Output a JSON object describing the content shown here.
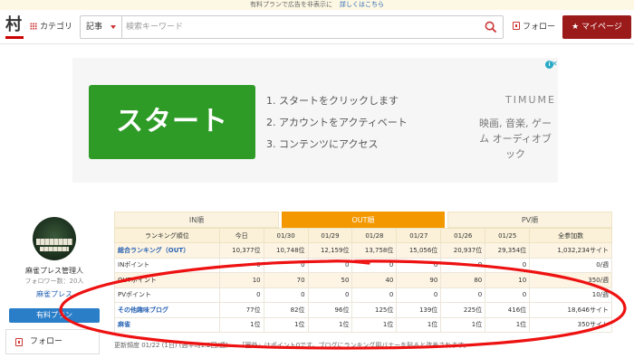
{
  "topbar": {
    "text": "有料プランで広告を非表示に",
    "link": "詳しくはこちら"
  },
  "header": {
    "logo": "村",
    "category_label": "カテゴリ",
    "search_type": "記事",
    "search_placeholder": "検索キーワード",
    "follow_label": "フォロー",
    "mypage_label": "マイページ"
  },
  "ad": {
    "start_button": "スタート",
    "steps": [
      "1. スタートをクリックします",
      "2. アカウントをアクティベート",
      "3. コンテンツにアクセス"
    ],
    "brand": "TIMUME",
    "desc": "映画, 音楽, ゲーム オーディオブック",
    "info_icon": "info-icon",
    "close_icon": "close-icon"
  },
  "profile": {
    "name": "麻雀プレス管理人",
    "followers": "フォロワー数：20人",
    "blog_name": "麻雀プレス",
    "paid_button": "有料プラン",
    "follow_label": "フォロー"
  },
  "ranking": {
    "tabs": [
      "IN順",
      "OUT順",
      "PV順"
    ],
    "active_tab": 1,
    "headers": [
      "ランキング順位",
      "今日",
      "01/30",
      "01/29",
      "01/28",
      "01/27",
      "01/26",
      "01/25",
      "全参加数"
    ],
    "rows": [
      {
        "label": "総合ランキング（OUT）",
        "link": true,
        "hl": true,
        "cells": [
          "10,377位",
          "10,748位",
          "12,159位",
          "13,758位",
          "15,056位",
          "20,937位",
          "29,354位",
          "1,032,234サイト"
        ]
      },
      {
        "label": "INポイント",
        "link": false,
        "hl": false,
        "cells": [
          "0",
          "0",
          "0",
          "0",
          "0",
          "0",
          "0",
          "0/週"
        ]
      },
      {
        "label": "OUTポイント",
        "link": false,
        "hl": true,
        "cells": [
          "10",
          "70",
          "50",
          "40",
          "90",
          "80",
          "10",
          "350/週"
        ]
      },
      {
        "label": "PVポイント",
        "link": false,
        "hl": false,
        "cells": [
          "0",
          "0",
          "0",
          "0",
          "0",
          "0",
          "0",
          "10/週"
        ]
      },
      {
        "label": "その他趣味ブログ",
        "link": true,
        "hl": false,
        "cells": [
          "77位",
          "82位",
          "96位",
          "125位",
          "139位",
          "225位",
          "416位",
          "18,646サイト"
        ]
      },
      {
        "label": "麻雀",
        "link": true,
        "hl": false,
        "cells": [
          "1位",
          "1位",
          "1位",
          "1位",
          "1位",
          "1位",
          "1位",
          "350サイト"
        ]
      }
    ],
    "footer": "更新頻度 01/22 (1日) (週平均1.2回/週)",
    "footer_note": "「圏外」はポイント0です。ブログにランキング用バナーを貼ると改善されます。"
  },
  "colors": {
    "accent_red": "#9b1b1b",
    "tab_orange": "#f39800",
    "ad_green": "#2e9b27",
    "annotation_red": "#e11"
  }
}
